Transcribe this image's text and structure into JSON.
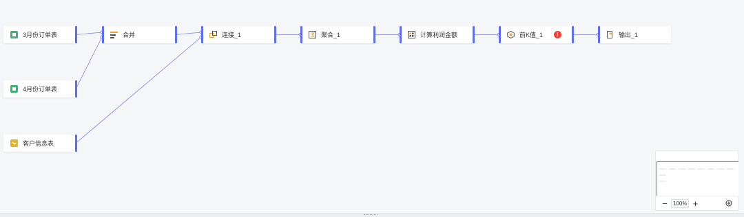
{
  "nodes": [
    {
      "id": "n1",
      "label": "3月份订单表",
      "icon": "table-green-icon"
    },
    {
      "id": "n2",
      "label": "4月份订单表",
      "icon": "table-green-icon"
    },
    {
      "id": "n3",
      "label": "客户信息表",
      "icon": "table-yellow-icon"
    },
    {
      "id": "n4",
      "label": "合并",
      "icon": "merge-icon"
    },
    {
      "id": "n5",
      "label": "连接_1",
      "icon": "join-icon"
    },
    {
      "id": "n6",
      "label": "聚合_1",
      "icon": "aggregate-icon"
    },
    {
      "id": "n7",
      "label": "计算利润金额",
      "icon": "calculate-icon"
    },
    {
      "id": "n8",
      "label": "前K值_1",
      "icon": "topk-icon",
      "error": "!"
    },
    {
      "id": "n9",
      "label": "输出_1",
      "icon": "output-icon"
    }
  ],
  "edges": [
    [
      "n1",
      "n4"
    ],
    [
      "n2",
      "n4"
    ],
    [
      "n4",
      "n5"
    ],
    [
      "n3",
      "n5"
    ],
    [
      "n5",
      "n6"
    ],
    [
      "n6",
      "n7"
    ],
    [
      "n7",
      "n8"
    ],
    [
      "n8",
      "n9"
    ]
  ],
  "minimap": {
    "zoom": "100%",
    "zoom_out_label": "−",
    "zoom_in_label": "+",
    "fit_icon": "target-icon"
  },
  "colors": {
    "accent": "#5c6ff0",
    "edge": "#7b84e8",
    "error": "#e8483b",
    "table_green": "#3cb371",
    "table_yellow": "#e6b422",
    "op_orange": "#e8a33a"
  }
}
